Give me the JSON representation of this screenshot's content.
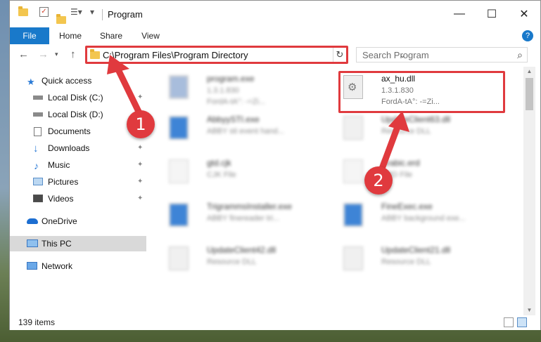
{
  "window": {
    "title": "Program",
    "controls": {
      "minimize": "—",
      "maximize": "☐",
      "close": "✕"
    }
  },
  "ribbon": {
    "tabs": [
      "File",
      "Home",
      "Share",
      "View"
    ],
    "help": "?"
  },
  "address": {
    "path": "C:\\Program Files\\Program Directory",
    "search_placeholder": "Search Program"
  },
  "nav": {
    "items": [
      {
        "label": "Quick access",
        "icon": "star-icon",
        "pinned": false
      },
      {
        "label": "Local Disk (C:)",
        "icon": "drive-icon",
        "pinned": true
      },
      {
        "label": "Local Disk (D:)",
        "icon": "drive-icon",
        "pinned": false
      },
      {
        "label": "Documents",
        "icon": "documents-icon",
        "pinned": true
      },
      {
        "label": "Downloads",
        "icon": "download-icon",
        "pinned": true
      },
      {
        "label": "Music",
        "icon": "music-icon",
        "pinned": true
      },
      {
        "label": "Pictures",
        "icon": "pictures-icon",
        "pinned": true
      },
      {
        "label": "Videos",
        "icon": "videos-icon",
        "pinned": true
      },
      {
        "label": "OneDrive",
        "icon": "onedrive-icon",
        "pinned": false
      },
      {
        "label": "This PC",
        "icon": "pc-icon",
        "pinned": false
      },
      {
        "label": "Network",
        "icon": "network-icon",
        "pinned": false
      }
    ]
  },
  "files": [
    {
      "name": "program.exe",
      "line1": "1.3.1.830",
      "line2": "FordA-tA°: -=Zi...",
      "type": "exe"
    },
    {
      "name": "ax_hu.dll",
      "line1": "1.3.1.830",
      "line2": "FordA-tA°: -=Zi...",
      "type": "dll"
    },
    {
      "name": "AbbyySTI.exe",
      "line1": "ABBY sti event hand...",
      "line2": "",
      "type": "exe"
    },
    {
      "name": "UpdateClient63.dll",
      "line1": "Resource DLL",
      "line2": "",
      "type": "dll"
    },
    {
      "name": "gtd.cjk",
      "line1": "CJK File",
      "line2": "",
      "type": "doc"
    },
    {
      "name": "Arabic.erd",
      "line1": "ERD File",
      "line2": "",
      "type": "doc"
    },
    {
      "name": "TrigrammsInstaller.exe",
      "line1": "ABBY finereader tri...",
      "line2": "",
      "type": "exe"
    },
    {
      "name": "FineExec.exe",
      "line1": "ABBY background exe...",
      "line2": "",
      "type": "exe"
    },
    {
      "name": "UpdateClient42.dll",
      "line1": "Resource DLL",
      "line2": "",
      "type": "dll"
    },
    {
      "name": "UpdateClient21.dll",
      "line1": "Resource DLL",
      "line2": "",
      "type": "dll"
    }
  ],
  "status": {
    "items_count": "139 items"
  },
  "annotations": {
    "step1": "1",
    "step2": "2",
    "color": "#e03a3e"
  }
}
